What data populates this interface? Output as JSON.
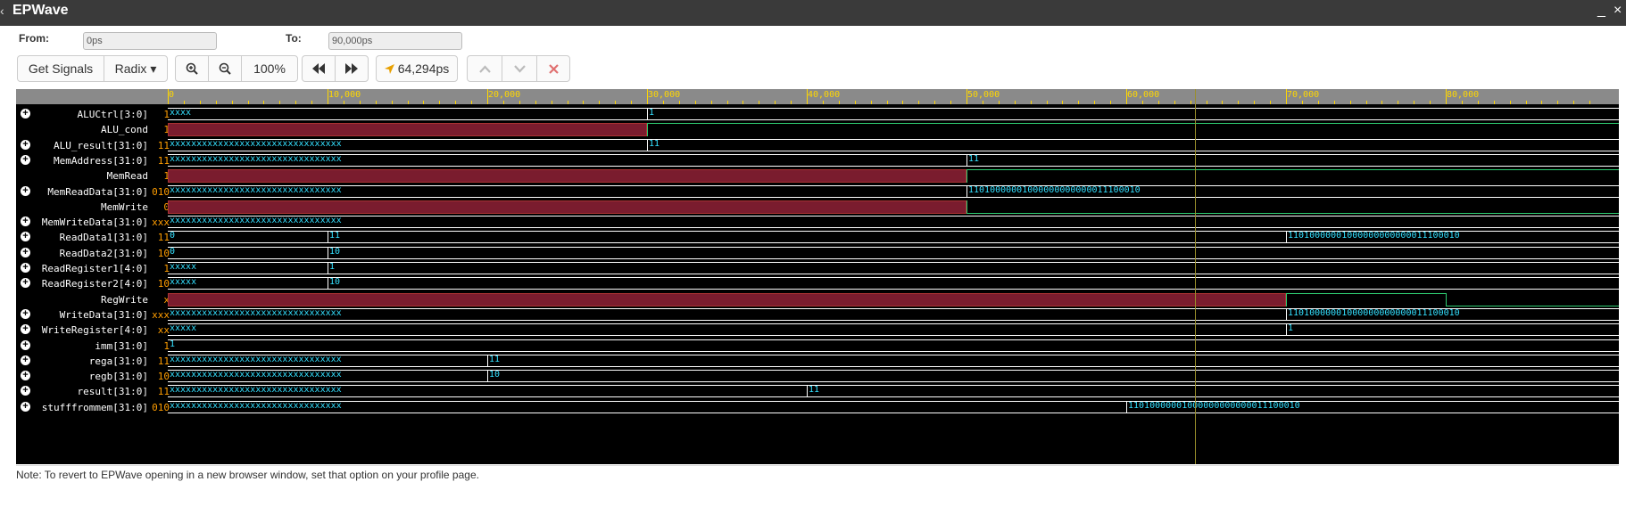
{
  "window": {
    "title": "EPWave",
    "left_icon": "chevron-left-icon",
    "minimize": "_",
    "close": "×"
  },
  "range": {
    "from_label": "From:",
    "from_value": "0ps",
    "to_label": "To:",
    "to_value": "90,000ps"
  },
  "toolbar": {
    "get_signals": "Get Signals",
    "radix": "Radix ▾",
    "zoom_in_icon": "zoom-in-icon",
    "zoom_out_icon": "zoom-out-icon",
    "zoom_level": "100%",
    "prev_icon": "rewind-icon",
    "next_icon": "fast-forward-icon",
    "cursor_time": "64,294ps",
    "up_icon": "chevron-up-icon",
    "down_icon": "chevron-down-icon",
    "delete_icon": "delete-icon"
  },
  "ruler": {
    "ticks": [
      "0",
      "10,000",
      "20,000",
      "30,000",
      "40,000",
      "50,000",
      "60,000",
      "70,000",
      "80,000"
    ]
  },
  "timeline": {
    "start": 0,
    "end": 90000,
    "cursor": 64294
  },
  "signals": [
    {
      "name": "ALUCtrl[3:0]",
      "value": "1",
      "expandable": true,
      "kind": "bus",
      "segments": [
        {
          "t": 0,
          "label": "xxxx"
        },
        {
          "t": 30000,
          "label": "1"
        }
      ]
    },
    {
      "name": "ALU_cond",
      "value": "1",
      "expandable": false,
      "kind": "bit",
      "segments": [
        {
          "t": 0,
          "level": "x"
        },
        {
          "t": 30000,
          "level": "1"
        }
      ]
    },
    {
      "name": "ALU_result[31:0]",
      "value": "11",
      "expandable": true,
      "kind": "bus",
      "segments": [
        {
          "t": 0,
          "label": "xxxxxxxxxxxxxxxxxxxxxxxxxxxxxxxx"
        },
        {
          "t": 30000,
          "label": "11"
        }
      ]
    },
    {
      "name": "MemAddress[31:0]",
      "value": "11",
      "expandable": true,
      "kind": "bus",
      "segments": [
        {
          "t": 0,
          "label": "xxxxxxxxxxxxxxxxxxxxxxxxxxxxxxxx"
        },
        {
          "t": 50000,
          "label": "11"
        }
      ]
    },
    {
      "name": "MemRead",
      "value": "1",
      "expandable": false,
      "kind": "bit",
      "segments": [
        {
          "t": 0,
          "level": "x"
        },
        {
          "t": 50000,
          "level": "1"
        }
      ]
    },
    {
      "name": "MemReadData[31:0]",
      "value": "010",
      "expandable": true,
      "kind": "bus",
      "segments": [
        {
          "t": 0,
          "label": "xxxxxxxxxxxxxxxxxxxxxxxxxxxxxxxx"
        },
        {
          "t": 50000,
          "label": "11010000001000000000000011100010"
        }
      ]
    },
    {
      "name": "MemWrite",
      "value": "0",
      "expandable": false,
      "kind": "bit",
      "segments": [
        {
          "t": 0,
          "level": "x"
        },
        {
          "t": 50000,
          "level": "0"
        }
      ]
    },
    {
      "name": "MemWriteData[31:0]",
      "value": "xxx",
      "expandable": true,
      "kind": "bus",
      "segments": [
        {
          "t": 0,
          "label": "xxxxxxxxxxxxxxxxxxxxxxxxxxxxxxxx"
        }
      ]
    },
    {
      "name": "ReadData1[31:0]",
      "value": "11",
      "expandable": true,
      "kind": "bus",
      "segments": [
        {
          "t": 0,
          "label": "0"
        },
        {
          "t": 10000,
          "label": "11"
        },
        {
          "t": 70000,
          "label": "11010000001000000000000011100010"
        }
      ]
    },
    {
      "name": "ReadData2[31:0]",
      "value": "10",
      "expandable": true,
      "kind": "bus",
      "segments": [
        {
          "t": 0,
          "label": "0"
        },
        {
          "t": 10000,
          "label": "10"
        }
      ]
    },
    {
      "name": "ReadRegister1[4:0]",
      "value": "1",
      "expandable": true,
      "kind": "bus",
      "segments": [
        {
          "t": 0,
          "label": "xxxxx"
        },
        {
          "t": 10000,
          "label": "1"
        }
      ]
    },
    {
      "name": "ReadRegister2[4:0]",
      "value": "10",
      "expandable": true,
      "kind": "bus",
      "segments": [
        {
          "t": 0,
          "label": "xxxxx"
        },
        {
          "t": 10000,
          "label": "10"
        }
      ]
    },
    {
      "name": "RegWrite",
      "value": "x",
      "expandable": false,
      "kind": "bit",
      "segments": [
        {
          "t": 0,
          "level": "x"
        },
        {
          "t": 70000,
          "level": "1"
        },
        {
          "t": 80000,
          "level": "0"
        }
      ]
    },
    {
      "name": "WriteData[31:0]",
      "value": "xxx",
      "expandable": true,
      "kind": "bus",
      "segments": [
        {
          "t": 0,
          "label": "xxxxxxxxxxxxxxxxxxxxxxxxxxxxxxxx"
        },
        {
          "t": 70000,
          "label": "11010000001000000000000011100010"
        }
      ]
    },
    {
      "name": "WriteRegister[4:0]",
      "value": "xx",
      "expandable": true,
      "kind": "bus",
      "segments": [
        {
          "t": 0,
          "label": "xxxxx"
        },
        {
          "t": 70000,
          "label": "1"
        }
      ]
    },
    {
      "name": "imm[31:0]",
      "value": "1",
      "expandable": true,
      "kind": "bus",
      "segments": [
        {
          "t": 0,
          "label": "1"
        }
      ]
    },
    {
      "name": "rega[31:0]",
      "value": "11",
      "expandable": true,
      "kind": "bus",
      "segments": [
        {
          "t": 0,
          "label": "xxxxxxxxxxxxxxxxxxxxxxxxxxxxxxxx"
        },
        {
          "t": 20000,
          "label": "11"
        }
      ]
    },
    {
      "name": "regb[31:0]",
      "value": "10",
      "expandable": true,
      "kind": "bus",
      "segments": [
        {
          "t": 0,
          "label": "xxxxxxxxxxxxxxxxxxxxxxxxxxxxxxxx"
        },
        {
          "t": 20000,
          "label": "10"
        }
      ]
    },
    {
      "name": "result[31:0]",
      "value": "11",
      "expandable": true,
      "kind": "bus",
      "segments": [
        {
          "t": 0,
          "label": "xxxxxxxxxxxxxxxxxxxxxxxxxxxxxxxx"
        },
        {
          "t": 40000,
          "label": "11"
        }
      ]
    },
    {
      "name": "stufffrommem[31:0]",
      "value": "010",
      "expandable": true,
      "kind": "bus",
      "segments": [
        {
          "t": 0,
          "label": "xxxxxxxxxxxxxxxxxxxxxxxxxxxxxxxx"
        },
        {
          "t": 60000,
          "label": "11010000001000000000000011100010"
        }
      ]
    }
  ],
  "note": "Note: To revert to EPWave opening in a new browser window, set that option on your profile page.",
  "colors": {
    "bus_text": "#33e0ff",
    "value_text": "#ff9d00",
    "x_fill": "#7a1c2e",
    "bit_line": "#2ecc71",
    "ruler_text": "#ffd700"
  }
}
